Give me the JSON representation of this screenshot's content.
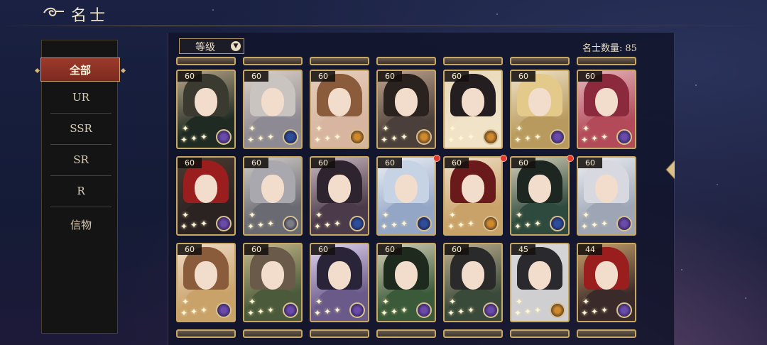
{
  "header": {
    "title": "名士"
  },
  "sidebar": {
    "items": [
      {
        "label": "全部",
        "active": true
      },
      {
        "label": "UR"
      },
      {
        "label": "SSR"
      },
      {
        "label": "SR"
      },
      {
        "label": "R"
      },
      {
        "label": "信物"
      }
    ]
  },
  "toolbar": {
    "sort_label": "等级",
    "sort_icon": "chevron-down-icon",
    "count_label": "名士数量:",
    "count_value": "85"
  },
  "cards": [
    {
      "level": "60",
      "element": "purple"
    },
    {
      "level": "60",
      "element": "blue"
    },
    {
      "level": "60",
      "element": "orange"
    },
    {
      "level": "60",
      "element": "orange"
    },
    {
      "level": "60",
      "element": "orange"
    },
    {
      "level": "60",
      "element": "purple"
    },
    {
      "level": "60",
      "element": "purple"
    },
    {
      "level": "60",
      "element": "purple"
    },
    {
      "level": "60",
      "element": "gray"
    },
    {
      "level": "60",
      "element": "blue"
    },
    {
      "level": "60",
      "element": "blue",
      "reddot": true
    },
    {
      "level": "60",
      "element": "orange",
      "reddot": true
    },
    {
      "level": "60",
      "element": "blue",
      "reddot": true
    },
    {
      "level": "60",
      "element": "purple"
    },
    {
      "level": "60",
      "element": "purple"
    },
    {
      "level": "60",
      "element": "purple"
    },
    {
      "level": "60",
      "element": "purple"
    },
    {
      "level": "60",
      "element": "purple"
    },
    {
      "level": "60",
      "element": "purple"
    },
    {
      "level": "45",
      "element": "orange"
    },
    {
      "level": "44",
      "element": "purple"
    }
  ],
  "colors": {
    "accent_red": "#9b3a2c",
    "gold_border": "#c9a962",
    "panel_bg": "#141414"
  }
}
